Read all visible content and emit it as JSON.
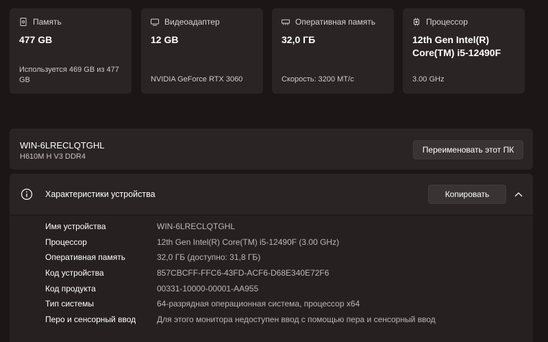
{
  "cards": [
    {
      "icon": "storage-icon",
      "title": "Память",
      "value": "477 GB",
      "sub": "Используется 469 GB из 477 GB"
    },
    {
      "icon": "gpu-icon",
      "title": "Видеоадаптер",
      "value": "12 GB",
      "sub": "NVIDIA GeForce RTX 3060"
    },
    {
      "icon": "ram-icon",
      "title": "Оперативная память",
      "value": "32,0 ГБ",
      "sub": "Скорость: 3200 МТ/с"
    },
    {
      "icon": "cpu-icon",
      "title": "Процессор",
      "value": "12th Gen Intel(R) Core(TM) i5-12490F",
      "sub": "3.00 GHz"
    }
  ],
  "pc": {
    "name": "WIN-6LRECLQTGHL",
    "model": "H610M H V3 DDR4",
    "rename_label": "Переименовать этот ПК"
  },
  "specs": {
    "title": "Характеристики устройства",
    "copy_label": "Копировать",
    "rows": [
      {
        "label": "Имя устройства",
        "value": "WIN-6LRECLQTGHL"
      },
      {
        "label": "Процессор",
        "value": "12th Gen Intel(R) Core(TM) i5-12490F (3.00 GHz)"
      },
      {
        "label": "Оперативная память",
        "value": "32,0 ГБ (доступно: 31,8 ГБ)"
      },
      {
        "label": "Код устройства",
        "value": "857CBCFF-FFC6-43FD-ACF6-D68E340E72F6"
      },
      {
        "label": "Код продукта",
        "value": "00331-10000-00001-AA955"
      },
      {
        "label": "Тип системы",
        "value": "64-разрядная операционная система, процессор x64"
      },
      {
        "label": "Перо и сенсорный ввод",
        "value": "Для этого монитора недоступен ввод с помощью пера и сенсорный ввод"
      }
    ]
  }
}
